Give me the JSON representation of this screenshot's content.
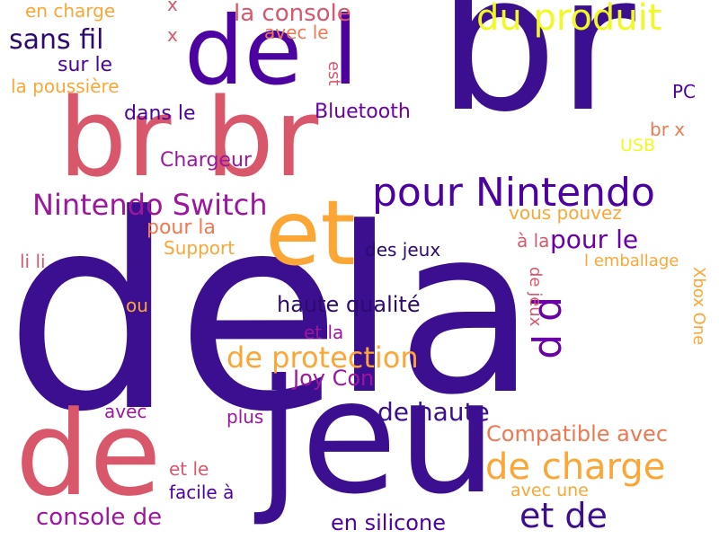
{
  "words": [
    {
      "text": "de",
      "color": "#3b0f8f"
    },
    {
      "text": "la",
      "color": "#3b0f8f"
    },
    {
      "text": "br",
      "color": "#3b0f8f"
    },
    {
      "text": "jeu",
      "color": "#3b0f8f"
    },
    {
      "text": "de",
      "color": "#d8576b"
    },
    {
      "text": "br br",
      "color": "#d8576b"
    },
    {
      "text": "de l",
      "color": "#4c02a1"
    },
    {
      "text": "et",
      "color": "#fca636"
    },
    {
      "text": "pour Nintendo",
      "color": "#4c02a1"
    },
    {
      "text": "du produit",
      "color": "#f0f921"
    },
    {
      "text": "de charge",
      "color": "#fca636"
    },
    {
      "text": "et de",
      "color": "#3b0f8f"
    },
    {
      "text": "Nintendo Switch",
      "color": "#9c179e"
    },
    {
      "text": "sans fil",
      "color": "#2d0a6e"
    },
    {
      "text": "la console",
      "color": "#d8576b"
    },
    {
      "text": "p p",
      "color": "#6a00a8"
    },
    {
      "text": "de protection",
      "color": "#fca636"
    },
    {
      "text": "de haute",
      "color": "#3b0f8f"
    },
    {
      "text": "console de",
      "color": "#9c179e"
    },
    {
      "text": "Compatible avec",
      "color": "#ed7953"
    },
    {
      "text": "haute qualité",
      "color": "#2d0a6e"
    },
    {
      "text": "Joy Con",
      "color": "#9c179e"
    },
    {
      "text": "pour le",
      "color": "#6a00a8"
    },
    {
      "text": "en silicone",
      "color": "#4c02a1"
    },
    {
      "text": "sur le",
      "color": "#4c02a1"
    },
    {
      "text": "dans le",
      "color": "#4c02a1"
    },
    {
      "text": "Chargeur",
      "color": "#9c179e"
    },
    {
      "text": "Bluetooth",
      "color": "#6a00a8"
    },
    {
      "text": "pour la",
      "color": "#ed7953"
    },
    {
      "text": "Support",
      "color": "#fca636"
    },
    {
      "text": "vous pouvez",
      "color": "#fca636"
    },
    {
      "text": "des jeux",
      "color": "#2d0a6e"
    },
    {
      "text": "à la",
      "color": "#d8576b"
    },
    {
      "text": "li li",
      "color": "#d8576b"
    },
    {
      "text": "ou",
      "color": "#fca636"
    },
    {
      "text": "et la",
      "color": "#9c179e"
    },
    {
      "text": "avec",
      "color": "#9c179e"
    },
    {
      "text": "plus",
      "color": "#9c179e"
    },
    {
      "text": "et le",
      "color": "#d8576b"
    },
    {
      "text": "facile à",
      "color": "#4c02a1"
    },
    {
      "text": "avec une",
      "color": "#fca636"
    },
    {
      "text": "en charge",
      "color": "#fca636"
    },
    {
      "text": "avec le",
      "color": "#ed7953"
    },
    {
      "text": "la poussière",
      "color": "#fca636"
    },
    {
      "text": "PC",
      "color": "#4c02a1"
    },
    {
      "text": "br x",
      "color": "#ed7953"
    },
    {
      "text": "USB",
      "color": "#f0f921"
    },
    {
      "text": "l emballage",
      "color": "#fca636"
    },
    {
      "text": "est",
      "color": "#d8576b"
    },
    {
      "text": "de jeux",
      "color": "#d8576b"
    },
    {
      "text": "Xbox One",
      "color": "#fca636"
    },
    {
      "text": "x",
      "color": "#d8576b"
    },
    {
      "text": "x",
      "color": "#d8576b"
    }
  ]
}
